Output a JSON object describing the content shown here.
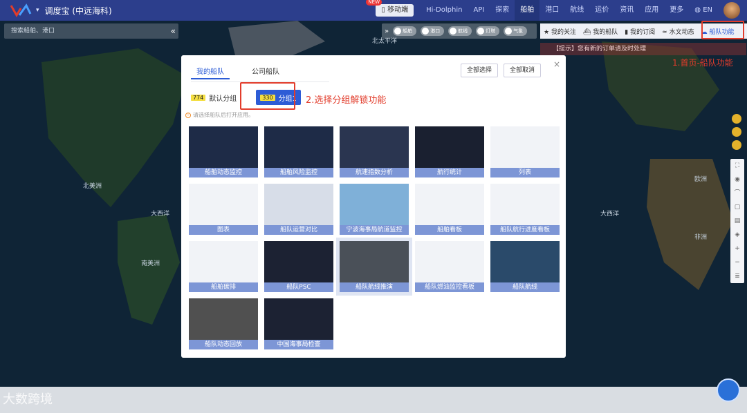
{
  "header": {
    "app_title": "调度宝 (中远海科)",
    "mobile_label": "移动端",
    "new_badge": "NEW",
    "nav": [
      "Hi-Dolphin",
      "API",
      "探索",
      "船舶",
      "港口",
      "航线",
      "运价",
      "资讯",
      "应用",
      "更多",
      "EN"
    ],
    "active_nav": "船舶"
  },
  "search": {
    "placeholder": "搜索船舶、港口"
  },
  "toggles": [
    "船舶",
    "港口",
    "航线",
    "灯塔",
    "气象"
  ],
  "quick": {
    "items": [
      "我的关注",
      "我的船队",
      "我的订阅",
      "水文动态",
      "船队功能"
    ],
    "icons": [
      "star-icon",
      "ship-icon",
      "bookmark-icon",
      "wave-icon",
      "fleet-icon"
    ]
  },
  "alert_bar": "【提示】您有新的订单请及时处理",
  "annotations": {
    "step1": "1.首页-船队功能",
    "step2": "2.选择分组解锁功能"
  },
  "map_labels": [
    "北美洲",
    "大西洋",
    "南美洲",
    "欧洲",
    "大西洋",
    "非洲",
    "北太平洋"
  ],
  "modal": {
    "tabs": [
      "我的船队",
      "公司船队"
    ],
    "select_all": "全部选择",
    "cancel_all": "全部取消",
    "groups": [
      {
        "count": "774",
        "name": "默认分组",
        "selected": false
      },
      {
        "count": "330",
        "name": "分组1",
        "selected": true
      }
    ],
    "notice": "请选择船队后打开应用。",
    "cards": [
      {
        "label": "船舶动态监控"
      },
      {
        "label": "船舶风险监控"
      },
      {
        "label": "航速指数分析"
      },
      {
        "label": "航行统计"
      },
      {
        "label": "列表"
      },
      {
        "label": "图表"
      },
      {
        "label": "船队运营对比"
      },
      {
        "label": "宁波海事局航道监控"
      },
      {
        "label": "船舶看板"
      },
      {
        "label": "船队航行进度看板"
      },
      {
        "label": "船舶碳排"
      },
      {
        "label": "船队PSC"
      },
      {
        "label": "船队航线推演"
      },
      {
        "label": "船队燃油监控看板"
      },
      {
        "label": "船队航线"
      },
      {
        "label": "船队动态回放"
      },
      {
        "label": "中国海事局检查"
      }
    ]
  },
  "watermark": "大数跨境",
  "colors": {
    "accent": "#2d5cd6",
    "header": "#2c3e8c",
    "annotation": "#e23c2b",
    "card_caption": "#7d96d6"
  }
}
